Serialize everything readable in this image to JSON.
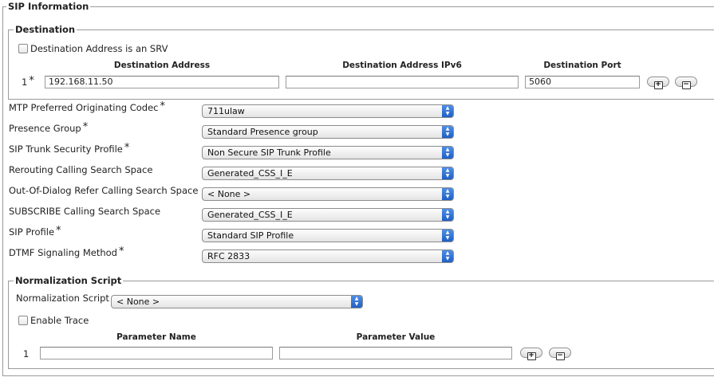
{
  "sip_section": {
    "title": "SIP Information",
    "destination": {
      "title": "Destination",
      "srv_checkbox_label": "Destination Address is an SRV",
      "headers": {
        "address": "Destination Address",
        "ipv6": "Destination Address IPv6",
        "port": "Destination Port"
      },
      "row": {
        "index": "1",
        "required_mark": "*",
        "address": "192.168.11.50",
        "ipv6": "",
        "port": "5060"
      }
    },
    "fields": [
      {
        "label": "MTP Preferred Originating Codec",
        "required": "*",
        "value": "711ulaw"
      },
      {
        "label": "Presence Group",
        "required": "*",
        "value": "Standard Presence group"
      },
      {
        "label": "SIP Trunk Security Profile",
        "required": "*",
        "value": "Non Secure SIP Trunk Profile"
      },
      {
        "label": "Rerouting Calling Search Space",
        "required": "",
        "value": "Generated_CSS_I_E"
      },
      {
        "label": "Out-Of-Dialog Refer Calling Search Space",
        "required": "",
        "value": "< None >"
      },
      {
        "label": "SUBSCRIBE Calling Search Space",
        "required": "",
        "value": "Generated_CSS_I_E"
      },
      {
        "label": "SIP Profile",
        "required": "*",
        "value": "Standard SIP Profile"
      },
      {
        "label": "DTMF Signaling Method",
        "required": "*",
        "value": "RFC 2833"
      }
    ],
    "normalization": {
      "title": "Normalization Script",
      "script_label": "Normalization Script",
      "script_value": "< None >",
      "enable_trace_label": "Enable Trace",
      "headers": {
        "name": "Parameter Name",
        "value": "Parameter Value"
      },
      "row": {
        "index": "1",
        "name": "",
        "value": ""
      }
    }
  },
  "icons": {
    "add": "plus-icon",
    "remove": "minus-icon",
    "dropdown": "up-down-arrows-icon"
  }
}
